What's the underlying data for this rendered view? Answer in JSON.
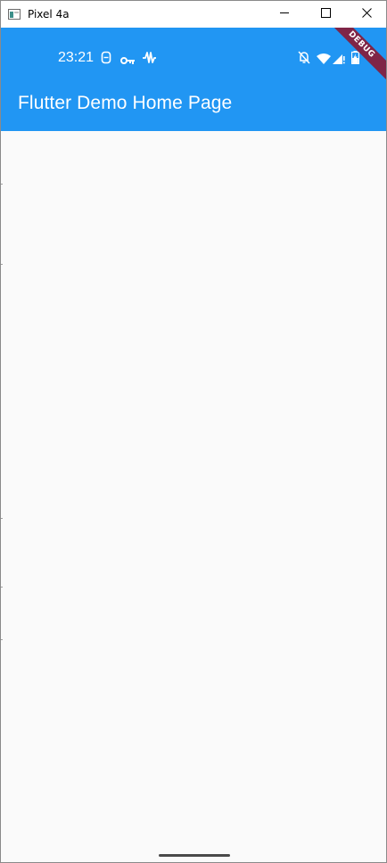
{
  "window": {
    "title": "Pixel 4a",
    "icon": "app-window-icon",
    "controls": [
      "minimize-icon",
      "maximize-icon",
      "close-icon"
    ]
  },
  "status_bar": {
    "time": "23:21",
    "left_icons": [
      "sim-card-icon",
      "vpn-key-icon",
      "activity-wave-icon"
    ],
    "right_icons": [
      "notifications-off-icon",
      "wifi-icon",
      "cellular-signal-icon",
      "battery-charging-icon"
    ]
  },
  "app_bar": {
    "title": "Flutter Demo Home Page",
    "color": "#2196f3"
  },
  "debug_banner": {
    "label": "DEBUG",
    "color": "#7f2547"
  },
  "colors": {
    "background": "#fafafa",
    "text_on_primary": "#ffffff"
  }
}
